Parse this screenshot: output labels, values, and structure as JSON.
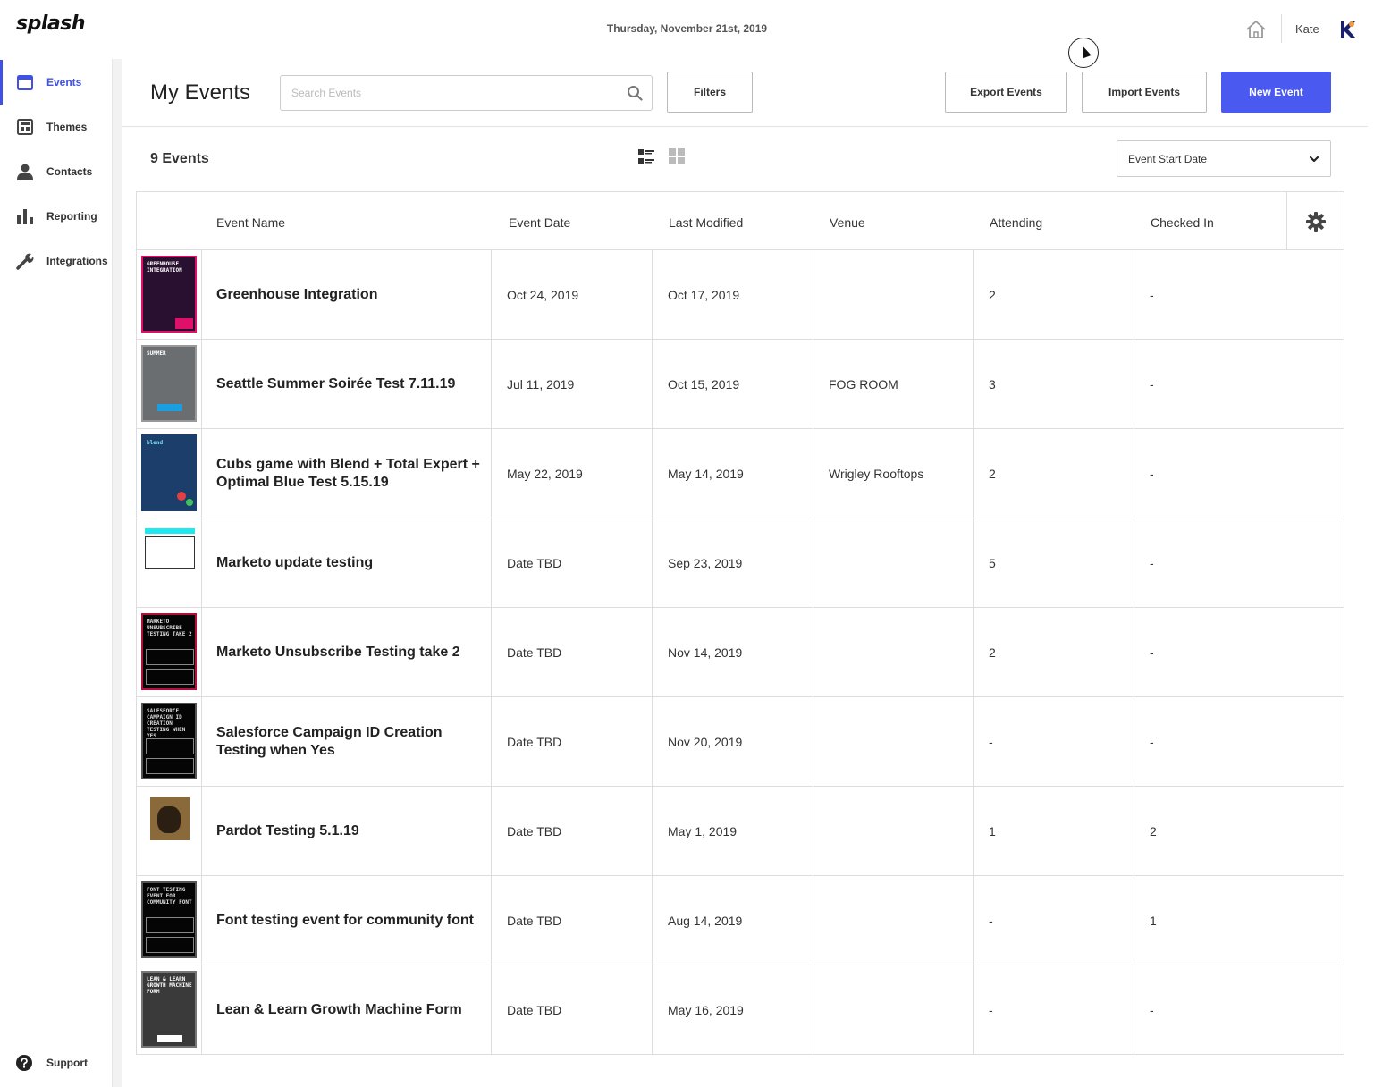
{
  "topbar": {
    "logo": "splash",
    "date": "Thursday, November 21st, 2019",
    "user_name": "Kate"
  },
  "sidebar": {
    "items": [
      {
        "label": "Events",
        "icon": "calendar-icon",
        "active": true
      },
      {
        "label": "Themes",
        "icon": "layout-icon"
      },
      {
        "label": "Contacts",
        "icon": "person-icon"
      },
      {
        "label": "Reporting",
        "icon": "bar-chart-icon"
      },
      {
        "label": "Integrations",
        "icon": "wrench-icon"
      }
    ],
    "support_label": "Support"
  },
  "header": {
    "title": "My Events",
    "search_placeholder": "Search Events",
    "filters_label": "Filters",
    "export_label": "Export Events",
    "import_label": "Import Events",
    "new_label": "New Event"
  },
  "toolbar": {
    "count": "9 Events",
    "sort_value": "Event Start Date"
  },
  "table": {
    "columns": [
      "Event Name",
      "Event Date",
      "Last Modified",
      "Venue",
      "Attending",
      "Checked In"
    ],
    "rows": [
      {
        "name_line1": "Greenhouse Integration",
        "name_line2": "",
        "date": "Oct 24, 2019",
        "modified": "Oct 17, 2019",
        "venue": "",
        "attending": "2",
        "checked_in": "-",
        "thumb_text": "GREENHOUSE INTEGRATION"
      },
      {
        "name_line1": "Seattle Summer Soirée Test 7.11.19",
        "name_line2": "",
        "date": "Jul 11, 2019",
        "modified": "Oct 15, 2019",
        "venue": "FOG ROOM",
        "attending": "3",
        "checked_in": "-",
        "thumb_text": "SUMMER"
      },
      {
        "name_line1": "Cubs game with Blend + Total Expert +",
        "name_line2": "Optimal Blue Test 5.15.19",
        "date": "May 22, 2019",
        "modified": "May 14, 2019",
        "venue": "Wrigley Rooftops",
        "attending": "2",
        "checked_in": "-",
        "thumb_text": "blend"
      },
      {
        "name_line1": "Marketo update testing",
        "name_line2": "",
        "date": "Date TBD",
        "modified": "Sep 23, 2019",
        "venue": "",
        "attending": "5",
        "checked_in": "-",
        "thumb_text": ""
      },
      {
        "name_line1": "Marketo Unsubscribe Testing take 2",
        "name_line2": "",
        "date": "Date TBD",
        "modified": "Nov 14, 2019",
        "venue": "",
        "attending": "2",
        "checked_in": "-",
        "thumb_text": "MARKETO UNSUBSCRIBE TESTING TAKE 2"
      },
      {
        "name_line1": "Salesforce Campaign ID Creation",
        "name_line2": "Testing when Yes",
        "date": "Date TBD",
        "modified": "Nov 20, 2019",
        "venue": "",
        "attending": "-",
        "checked_in": "-",
        "thumb_text": "SALESFORCE CAMPAIGN ID CREATION TESTING WHEN YES"
      },
      {
        "name_line1": "Pardot Testing 5.1.19",
        "name_line2": "",
        "date": "Date TBD",
        "modified": "May 1, 2019",
        "venue": "",
        "attending": "1",
        "checked_in": "2",
        "thumb_text": ""
      },
      {
        "name_line1": "Font testing event for community font",
        "name_line2": "",
        "date": "Date TBD",
        "modified": "Aug 14, 2019",
        "venue": "",
        "attending": "-",
        "checked_in": "1",
        "thumb_text": "FONT TESTING EVENT FOR COMMUNITY FONT"
      },
      {
        "name_line1": "Lean & Learn Growth Machine Form",
        "name_line2": "",
        "date": "Date TBD",
        "modified": "May 16, 2019",
        "venue": "",
        "attending": "-",
        "checked_in": "-",
        "thumb_text": "LEAN & LEARN GROWTH MACHINE FORM"
      }
    ]
  },
  "colors": {
    "accent": "#4a5af0",
    "sidebar_active": "#3f51e6",
    "border": "#dddddd"
  }
}
